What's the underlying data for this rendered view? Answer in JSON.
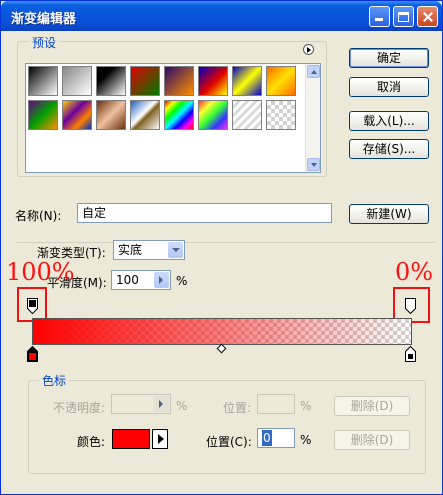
{
  "window": {
    "title": "渐变编辑器"
  },
  "presets": {
    "label": "预设",
    "swatches": [
      {
        "name": "black-white",
        "bg": "linear-gradient(135deg,#000 0%,#fff 100%)"
      },
      {
        "name": "fg-transparent",
        "bg": "linear-gradient(135deg,#888 0%,rgba(255,255,255,0) 100%)"
      },
      {
        "name": "black-white-2",
        "bg": "linear-gradient(135deg,#000 30%,#fff 100%)"
      },
      {
        "name": "red-green",
        "bg": "linear-gradient(135deg,#e00000 0%,#007a00 100%)"
      },
      {
        "name": "violet-orange",
        "bg": "linear-gradient(135deg,#2a0a6a 0%,#ff9000 100%)"
      },
      {
        "name": "blue-red-yellow",
        "bg": "linear-gradient(135deg,#0000c0 0%,#e00000 55%,#ffff00 100%)"
      },
      {
        "name": "blue-yellow-blue",
        "bg": "linear-gradient(135deg,#0000d0 0%,#ffff00 50%,#0000d0 100%)"
      },
      {
        "name": "orange-yellow-orange",
        "bg": "linear-gradient(135deg,#ff6a00 0%,#ffe000 50%,#ff6a00 100%)"
      },
      {
        "name": "violet-green-orange",
        "bg": "linear-gradient(135deg,#6a008a 0%,#00a000 50%,#ff9000 100%)"
      },
      {
        "name": "yellow-violet-orange-blue",
        "bg": "linear-gradient(135deg,#ffd000 0%,#6a00a0 40%,#ff8000 70%,#0030c0 100%)"
      },
      {
        "name": "copper",
        "bg": "linear-gradient(135deg,#6a3010 0%,#f0c0a0 50%,#6a3010 100%)"
      },
      {
        "name": "chrome",
        "bg": "linear-gradient(135deg,#2060c0 0%,#ffffff 45%,#806020 55%,#ffffff 100%)"
      },
      {
        "name": "spectrum",
        "bg": "linear-gradient(135deg,#ff0000,#ffff00,#00ff00,#00ffff,#0000ff,#ff00ff,#ff0000)"
      },
      {
        "name": "transparent-rainbow",
        "bg": "linear-gradient(135deg,rgba(255,0,0,.8),rgba(255,255,0,.8),rgba(0,255,0,.8),rgba(0,0,255,.8),rgba(255,0,255,.8))"
      },
      {
        "name": "transparent-stripes",
        "bg": "repeating-linear-gradient(135deg,#ffffff 0px,#ffffff 3px,#d8d8d8 3px,#d8d8d8 6px)"
      },
      {
        "name": "checker",
        "bg": "repeating-conic-gradient(#d0d0d0 0% 25%, #ffffff 0% 50%) 0 0/8px 8px"
      }
    ]
  },
  "buttons": {
    "ok": "确定",
    "cancel": "取消",
    "load": "载入(L)...",
    "save": "存储(S)...",
    "new": "新建(W)"
  },
  "name_field": {
    "label": "名称(N):",
    "value": "自定"
  },
  "gradient_type": {
    "label": "渐变类型(T):",
    "value": "实底"
  },
  "smoothness": {
    "label": "平滑度(M):",
    "value": "100",
    "unit": "%"
  },
  "annotations": {
    "left": "100%",
    "right": "0%"
  },
  "stops_section": {
    "label": "色标",
    "opacity_label": "不透明度:",
    "opacity_unit": "%",
    "opacity_position_label": "位置:",
    "opacity_position_unit": "%",
    "opacity_delete": "删除(D)",
    "color_label": "颜色:",
    "color_value": "#ff0000",
    "color_position_label": "位置(C):",
    "color_position_value": "0",
    "color_position_unit": "%",
    "color_delete": "删除(D)"
  },
  "colors": {
    "accent": "#0046d5",
    "stop_color": "#ff0000"
  }
}
